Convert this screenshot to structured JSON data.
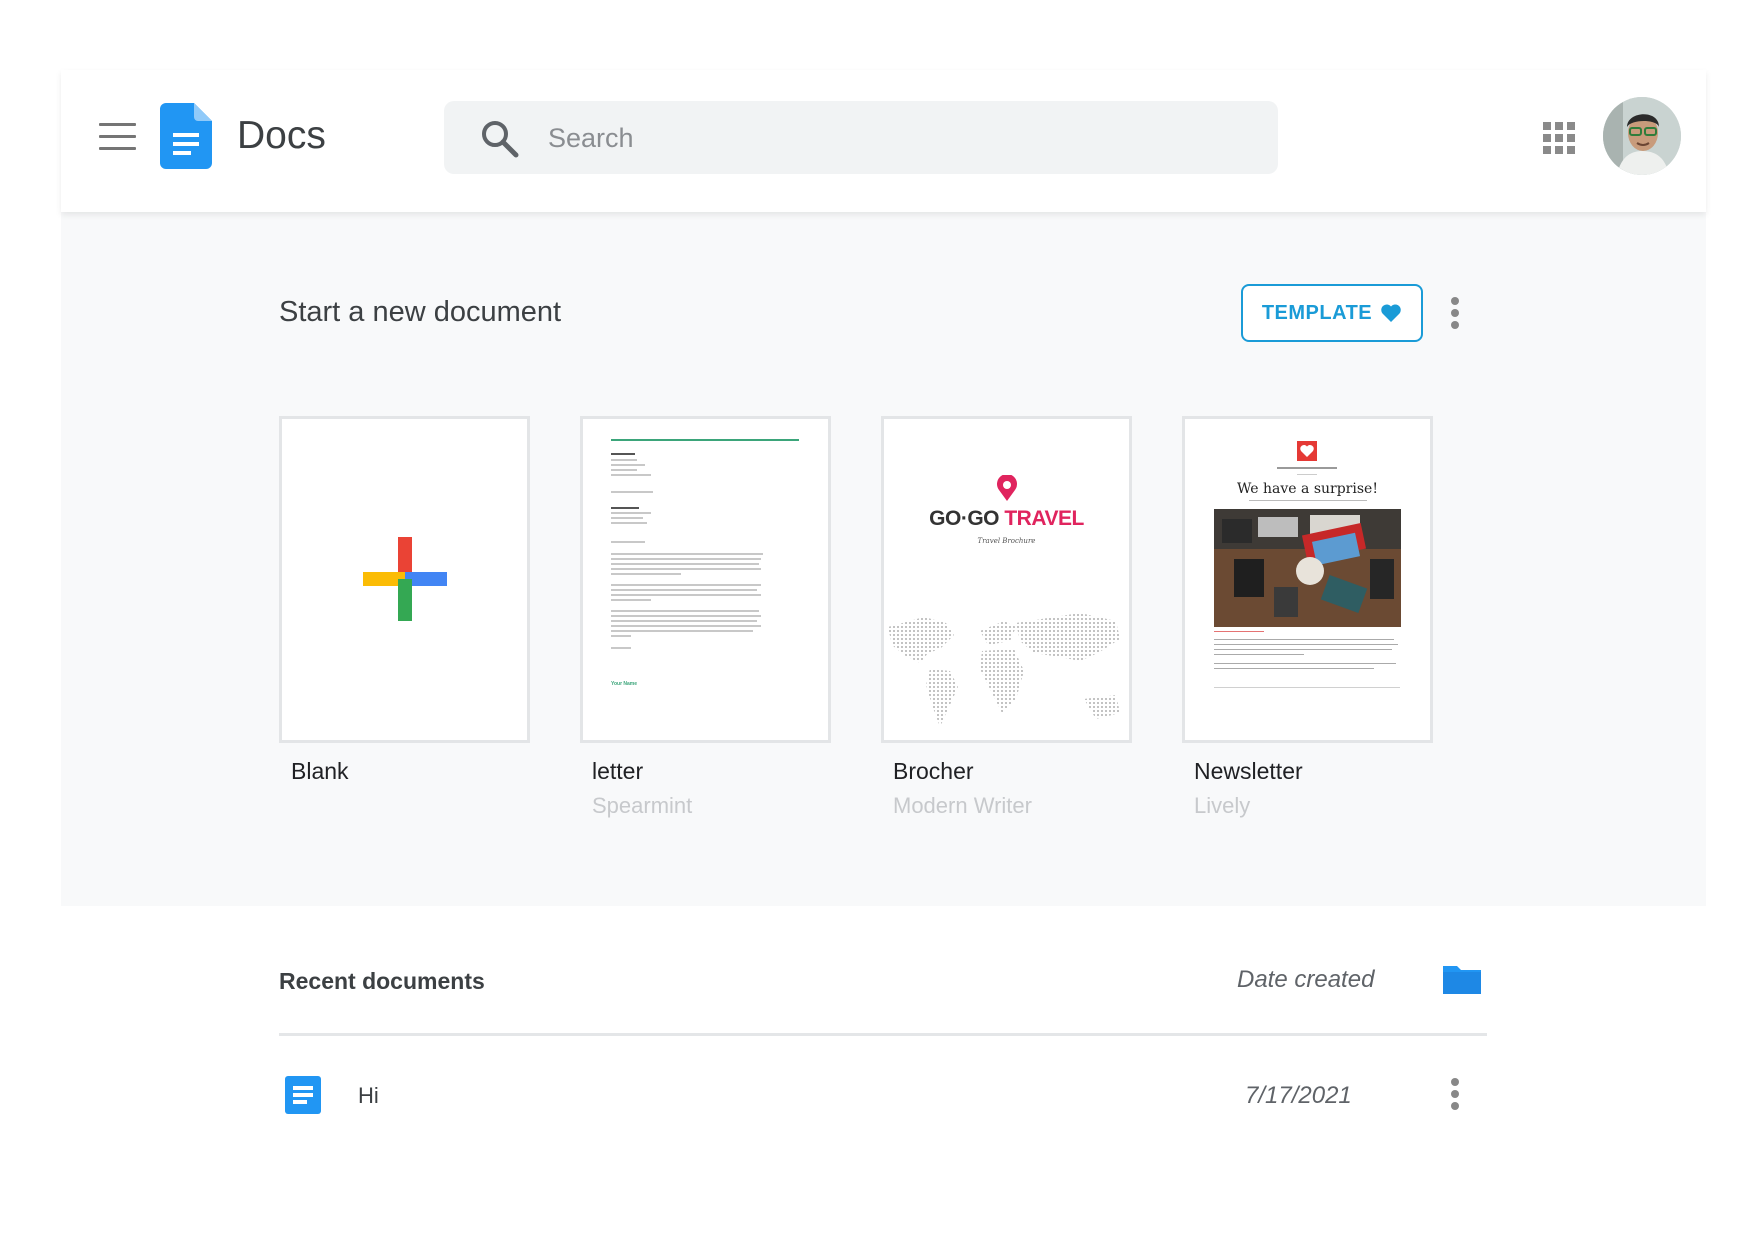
{
  "header": {
    "app_title": "Docs",
    "search": {
      "placeholder": "Search",
      "value": ""
    }
  },
  "templates": {
    "section_title": "Start a new document",
    "template_button_label": "TEMPLATE",
    "cards": [
      {
        "title": "Blank",
        "subtitle": ""
      },
      {
        "title": "letter",
        "subtitle": "Spearmint"
      },
      {
        "title": "Brocher",
        "subtitle": "Modern Writer"
      },
      {
        "title": "Newsletter",
        "subtitle": "Lively"
      }
    ],
    "brochure_thumb": {
      "logo_text": "GO·GO",
      "title_accent": "TRAVEL",
      "subtitle": "Travel Brochure"
    },
    "newsletter_thumb": {
      "headline": "We have a surprise!"
    },
    "letter_thumb": {
      "signature": "Your Name"
    }
  },
  "recent": {
    "title": "Recent documents",
    "sort_label": "Date created",
    "documents": [
      {
        "name": "Hi",
        "date": "7/17/2021"
      }
    ]
  },
  "colors": {
    "accent": "#1a9bd7",
    "docs_blue": "#2196f3",
    "plus_red": "#ea4335",
    "plus_blue": "#4285f4",
    "plus_yellow": "#fbbc05",
    "plus_green": "#34a853"
  },
  "icons": [
    "menu-icon",
    "docs-logo-icon",
    "search-icon",
    "apps-grid-icon",
    "heart-icon",
    "more-vert-icon",
    "folder-icon",
    "document-icon",
    "plus-icon"
  ]
}
